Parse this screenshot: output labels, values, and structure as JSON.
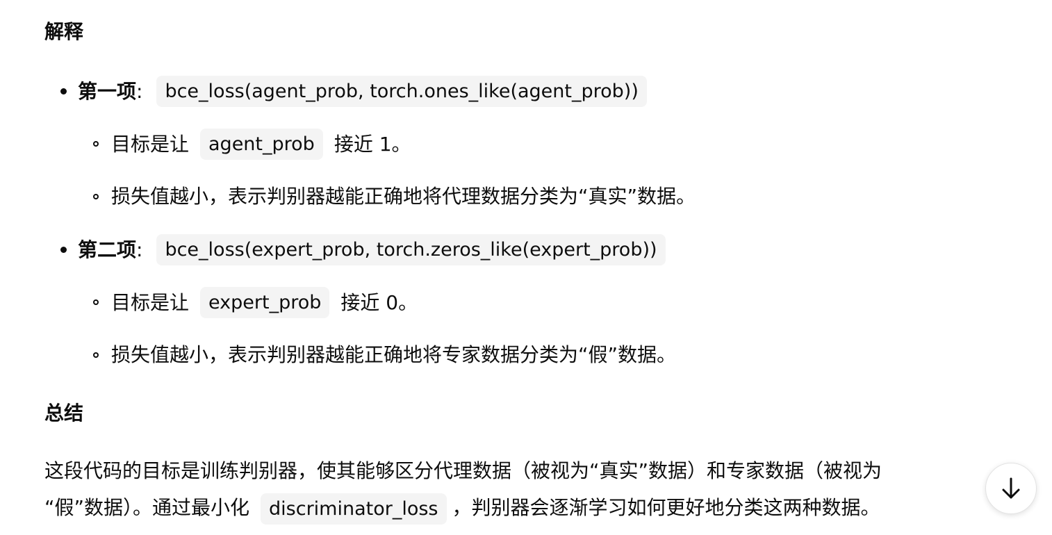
{
  "explanation": {
    "heading": "解释",
    "items": [
      {
        "label": "第一项",
        "colon": ":",
        "code": "bce_loss(agent_prob, torch.ones_like(agent_prob))",
        "sub": [
          {
            "before": "目标是让",
            "code": "agent_prob",
            "after": "接近 1。"
          },
          {
            "text": "损失值越小，表示判别器越能正确地将代理数据分类为“真实”数据。"
          }
        ]
      },
      {
        "label": "第二项",
        "colon": ":",
        "code": "bce_loss(expert_prob, torch.zeros_like(expert_prob))",
        "sub": [
          {
            "before": "目标是让",
            "code": "expert_prob",
            "after": "接近 0。"
          },
          {
            "text": "损失值越小，表示判别器越能正确地将专家数据分类为“假”数据。"
          }
        ]
      }
    ]
  },
  "summary": {
    "heading": "总结",
    "line1": "这段代码的目标是训练判别器，使其能够区分代理数据（被视为“真实”数据）和专家数据（被视为",
    "line2_before": "“假”数据）。通过最小化",
    "line2_code": "discriminator_loss",
    "line2_after": "，判别器会逐渐学习如何更好地分类这两种数据。"
  },
  "scroll_button": {
    "icon": "arrow-down-icon"
  }
}
